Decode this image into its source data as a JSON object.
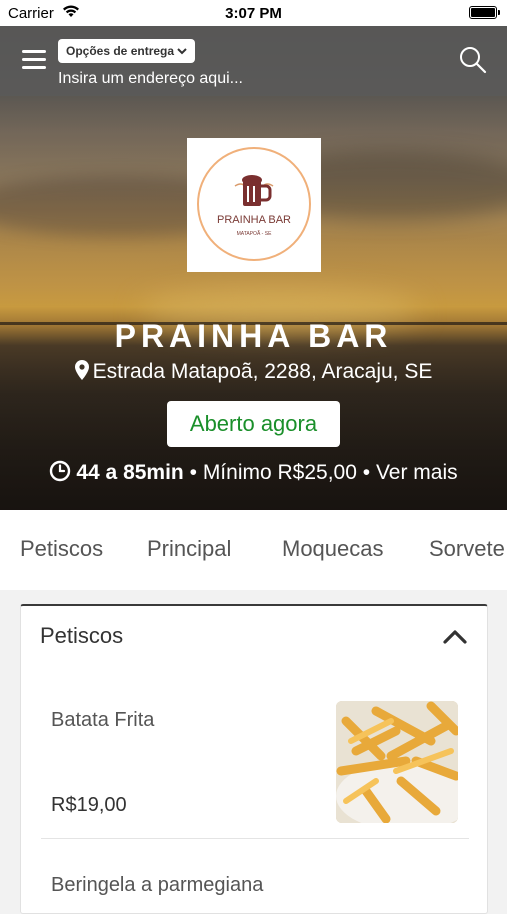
{
  "status_bar": {
    "carrier": "Carrier",
    "time": "3:07 PM"
  },
  "header": {
    "delivery_options_label": "Opções de entrega",
    "address_placeholder": "Insira um endereço aqui..."
  },
  "store": {
    "logo_name": "PRAINHA BAR",
    "logo_subtitle": "MATAPOÃ - SE",
    "name": "PRAINHA BAR",
    "address": "Estrada Matapoã, 2288, Aracaju, SE",
    "status": "Aberto agora",
    "eta": "44 a 85min",
    "separator": "•",
    "minimum": "Mínimo R$25,00",
    "more": "Ver mais"
  },
  "categories": [
    "Petiscos",
    "Principal",
    "Moquecas",
    "Sorvete"
  ],
  "section": {
    "title": "Petiscos",
    "items": [
      {
        "name": "Batata Frita",
        "price": "R$19,00"
      },
      {
        "name": "Beringela a parmegiana"
      }
    ]
  },
  "colors": {
    "open_green": "#1a8f2a",
    "header_gray": "#5a5a5a"
  }
}
